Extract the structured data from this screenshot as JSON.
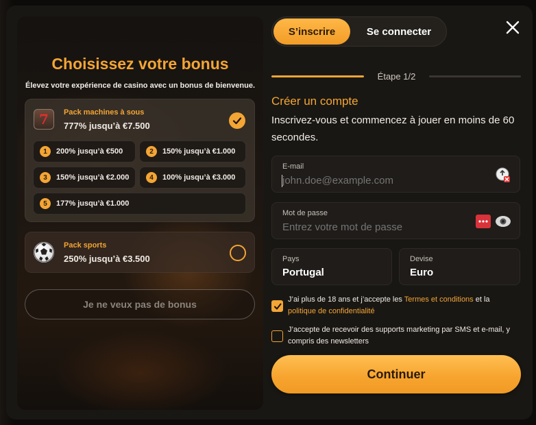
{
  "tabs": {
    "signup": "S’inscrire",
    "login": "Se connecter"
  },
  "bonus_panel": {
    "title": "Choisissez votre bonus",
    "subtitle": "Élevez votre expérience de casino avec un bonus de bienvenue.",
    "slots_pack": {
      "name": "Pack machines à sous",
      "value": "777% jusqu’à €7.500",
      "selected": true,
      "tiers": [
        {
          "num": "1",
          "label": "200% jusqu’à €500"
        },
        {
          "num": "2",
          "label": "150% jusqu’à €1.000"
        },
        {
          "num": "3",
          "label": "150% jusqu’à €2.000"
        },
        {
          "num": "4",
          "label": "100% jusqu’à €3.000"
        },
        {
          "num": "5",
          "label": "177% jusqu’à €1.000"
        }
      ]
    },
    "sports_pack": {
      "name": "Pack sports",
      "value": "250% jusqu’à €3.500",
      "selected": false
    },
    "no_bonus_label": "Je ne veux pas de bonus"
  },
  "step": {
    "label": "Étape 1/2",
    "progress": 0.5
  },
  "form": {
    "title": "Créer un compte",
    "description": "Inscrivez-vous et commencez à jouer en moins de 60 secondes.",
    "email": {
      "label": "E-mail",
      "placeholder": "john.doe@example.com"
    },
    "password": {
      "label": "Mot de passe",
      "placeholder": "Entrez votre mot de passe"
    },
    "country": {
      "label": "Pays",
      "value": "Portugal"
    },
    "currency": {
      "label": "Devise",
      "value": "Euro"
    },
    "consent_age": {
      "checked": true,
      "text_before": "J’ai plus de 18 ans et j’accepte les ",
      "terms_link": "Termes et conditions",
      "text_middle": " et la ",
      "privacy_link": "politique de confidentialité"
    },
    "consent_marketing": {
      "checked": false,
      "text": "J’accepte de recevoir des supports marketing par SMS et e-mail, y compris des newsletters"
    },
    "continue_label": "Continuer"
  },
  "colors": {
    "accent": "#f3a535",
    "modal_bg": "#191714",
    "field_bg": "#1f1c19"
  },
  "icons": [
    "slot-machine-icon",
    "check-icon",
    "soccer-ball-icon",
    "close-icon",
    "email-validate-icon",
    "password-manager-icon",
    "eye-icon"
  ]
}
